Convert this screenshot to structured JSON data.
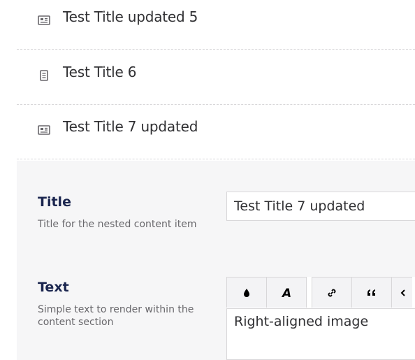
{
  "list": {
    "items": [
      {
        "label": "Test Title updated 5",
        "icon": "newspaper-icon"
      },
      {
        "label": "Test Title 6",
        "icon": "document-icon"
      },
      {
        "label": "Test Title 7 updated",
        "icon": "newspaper-icon"
      }
    ]
  },
  "editor": {
    "title": {
      "label": "Title",
      "description": "Title for the nested content item",
      "value": "Test Title 7 updated"
    },
    "text": {
      "label": "Text",
      "description": "Simple text to render within the content section",
      "content": "Right-aligned image",
      "toolbar": [
        "color-drop-icon",
        "font-style-icon",
        "link-icon",
        "quote-icon",
        "code-icon"
      ]
    }
  },
  "colors": {
    "panel_bg": "#f6f6f7",
    "border": "#d8d7d9",
    "heading": "#1b264f",
    "text": "#303033",
    "muted": "#68676b"
  }
}
